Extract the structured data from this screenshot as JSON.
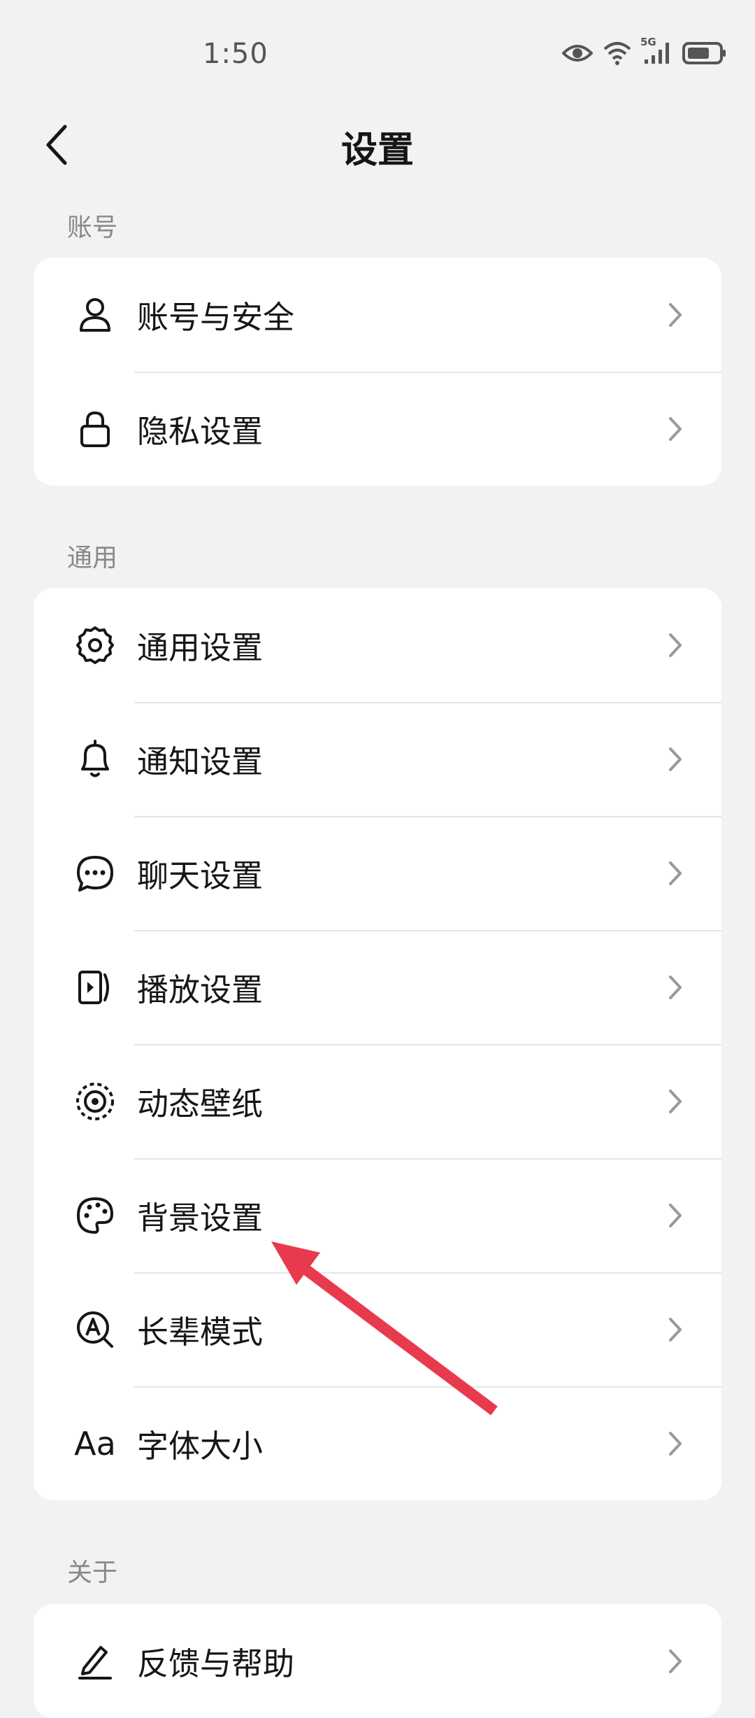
{
  "status_bar": {
    "time": "1:50",
    "network": "5G"
  },
  "header": {
    "title": "设置"
  },
  "sections": [
    {
      "label": "账号"
    },
    {
      "label": "通用"
    },
    {
      "label": "关于"
    }
  ],
  "account_items": [
    {
      "label": "账号与安全",
      "icon": "user-icon"
    },
    {
      "label": "隐私设置",
      "icon": "lock-icon"
    }
  ],
  "general_items": [
    {
      "label": "通用设置",
      "icon": "gear-icon"
    },
    {
      "label": "通知设置",
      "icon": "bell-icon"
    },
    {
      "label": "聊天设置",
      "icon": "chat-icon"
    },
    {
      "label": "播放设置",
      "icon": "play-icon"
    },
    {
      "label": "动态壁纸",
      "icon": "wallpaper-icon"
    },
    {
      "label": "背景设置",
      "icon": "palette-icon"
    },
    {
      "label": "长辈模式",
      "icon": "elder-mode-icon"
    },
    {
      "label": "字体大小",
      "icon": "font-size-icon",
      "glyph": "Aa"
    }
  ],
  "about_items": [
    {
      "label": "反馈与帮助",
      "icon": "pen-icon"
    }
  ],
  "annotation": {
    "color": "#e83a4c"
  }
}
